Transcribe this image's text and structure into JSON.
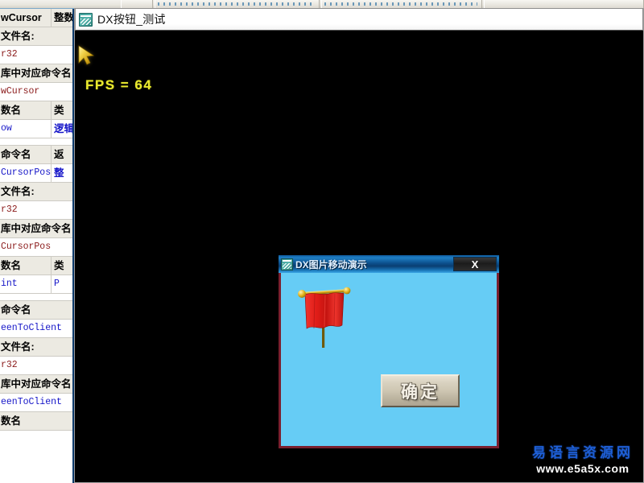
{
  "main_window": {
    "title": "DX按钮_测试",
    "app_icon": "yi-language-icon",
    "fps_label": "FPS = 64",
    "fps_color": "#e8e830",
    "canvas_color": "#000000",
    "cursor_icon": "gold-arrow-cursor"
  },
  "demo_dialog": {
    "title": "DX图片移动演示",
    "app_icon": "yi-language-icon",
    "close_label": "X",
    "client_color": "#66ccf5",
    "border_color": "#7a1f2e",
    "ok_button_label": "确定",
    "flag_icon": "red-banner-flag-icon"
  },
  "watermark": {
    "site_name": "易语言资源网",
    "url": "www.e5a5x.com",
    "site_color": "#1e5fd6"
  },
  "ide_background": {
    "toolstrip_cells": 4,
    "rows": [
      {
        "type": "header",
        "kind": "two",
        "c1": "wCursor",
        "c2": "整数"
      },
      {
        "type": "header",
        "kind": "full",
        "c1": "文件名:"
      },
      {
        "type": "value",
        "kind": "full",
        "c1": "r32",
        "style": "maroon"
      },
      {
        "type": "header",
        "kind": "full",
        "c1": "库中对应命令名"
      },
      {
        "type": "value",
        "kind": "full",
        "c1": "wCursor",
        "style": "maroon"
      },
      {
        "type": "header",
        "kind": "two",
        "c1": "数名",
        "c2": "类"
      },
      {
        "type": "value",
        "kind": "two",
        "c1": "ow",
        "c2": "逻辑",
        "style": "navy",
        "style2": "blue"
      },
      {
        "type": "spacer",
        "kind": "full",
        "c1": ""
      },
      {
        "type": "header",
        "kind": "two",
        "c1": "命令名",
        "c2": "返"
      },
      {
        "type": "value",
        "kind": "two",
        "c1": "CursorPos",
        "c2": "整",
        "style": "navy",
        "style2": "blue"
      },
      {
        "type": "header",
        "kind": "full",
        "c1": "文件名:"
      },
      {
        "type": "value",
        "kind": "full",
        "c1": "r32",
        "style": "maroon"
      },
      {
        "type": "header",
        "kind": "full",
        "c1": "库中对应命令名"
      },
      {
        "type": "value",
        "kind": "full",
        "c1": "CursorPos",
        "style": "maroon"
      },
      {
        "type": "header",
        "kind": "two",
        "c1": "数名",
        "c2": "类"
      },
      {
        "type": "value",
        "kind": "two",
        "c1": "int",
        "c2": "P",
        "style": "navy",
        "style2": "navy"
      },
      {
        "type": "spacer",
        "kind": "full",
        "c1": ""
      },
      {
        "type": "header",
        "kind": "full",
        "c1": "命令名"
      },
      {
        "type": "value",
        "kind": "full",
        "c1": "eenToClient",
        "style": "navy"
      },
      {
        "type": "header",
        "kind": "full",
        "c1": "文件名:"
      },
      {
        "type": "value",
        "kind": "full",
        "c1": "r32",
        "style": "maroon"
      },
      {
        "type": "header",
        "kind": "full",
        "c1": "库中对应命令名"
      },
      {
        "type": "value",
        "kind": "full",
        "c1": "eenToClient",
        "style": "navy"
      },
      {
        "type": "header",
        "kind": "full",
        "c1": "数名"
      }
    ]
  }
}
